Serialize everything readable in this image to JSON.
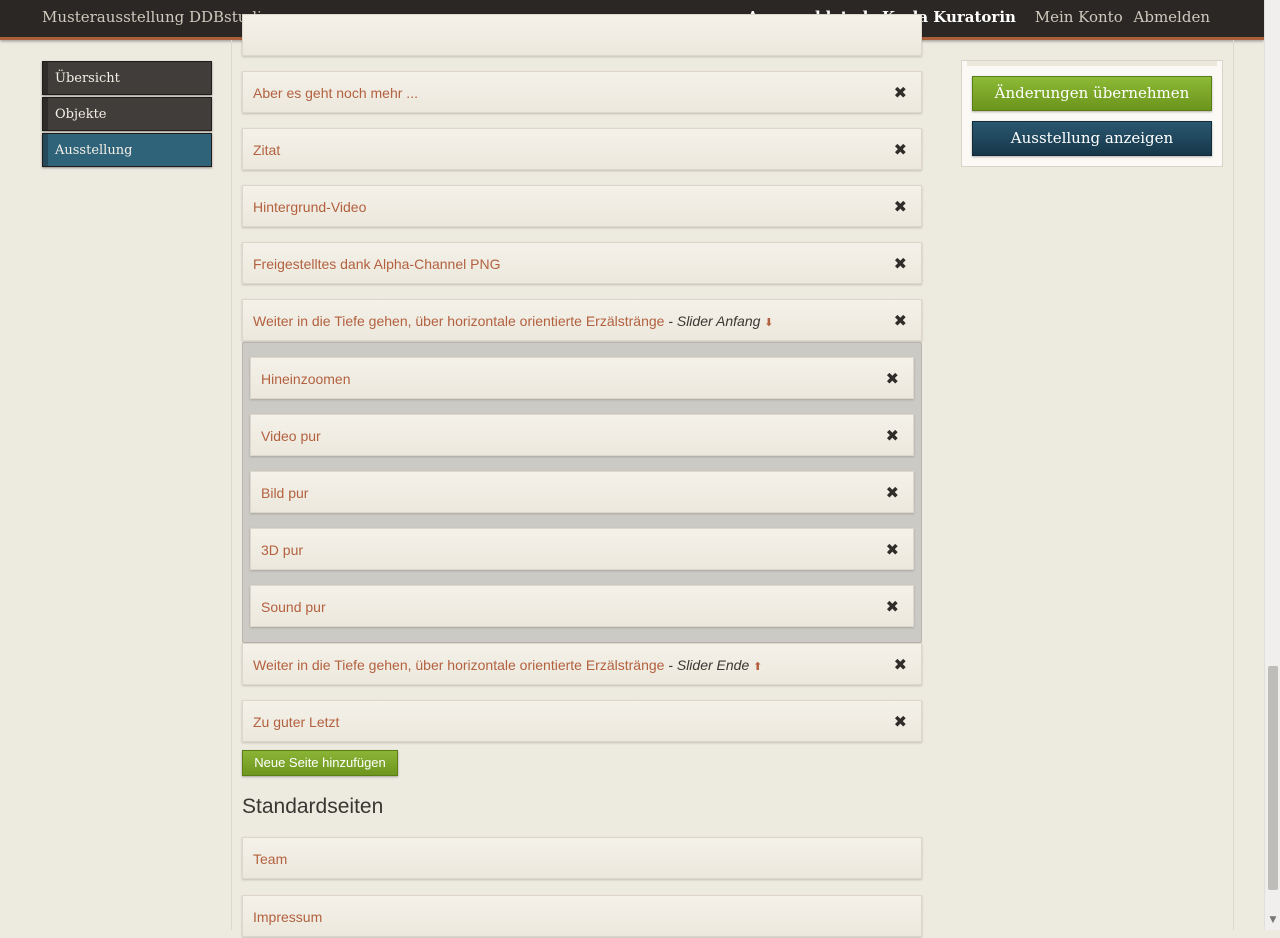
{
  "header": {
    "site_title": "Musterausstellung DDBstudio",
    "logged_in_as": "Angemeldet als Karla Kuratorin",
    "my_account": "Mein Konto",
    "logout": "Abmelden"
  },
  "sidebar": {
    "items": [
      {
        "label": "Übersicht",
        "active": false
      },
      {
        "label": "Objekte",
        "active": false
      },
      {
        "label": "Ausstellung",
        "active": true
      }
    ]
  },
  "pages": {
    "rows": [
      {
        "label": "Aber es geht noch mehr ..."
      },
      {
        "label": "Zitat"
      },
      {
        "label": "Hintergrund-Video"
      },
      {
        "label": "Freigestelltes dank Alpha-Channel PNG"
      },
      {
        "label": "Weiter in die Tiefe gehen, über horizontale orientierte Erzälstränge",
        "note": " - Slider Anfang ",
        "arrow": "⬇"
      }
    ],
    "slider_items": [
      {
        "label": "Hineinzoomen"
      },
      {
        "label": "Video pur"
      },
      {
        "label": "Bild pur"
      },
      {
        "label": "3D pur"
      },
      {
        "label": "Sound pur"
      }
    ],
    "after_rows": [
      {
        "label": "Weiter in die Tiefe gehen, über horizontale orientierte Erzälstränge",
        "note": " - Slider Ende ",
        "arrow": "⬆"
      },
      {
        "label": "Zu guter Letzt"
      }
    ],
    "remove_glyph": "✖",
    "add_button": "Neue Seite hinzufügen"
  },
  "standard_pages": {
    "title": "Standardseiten",
    "rows": [
      {
        "label": "Team"
      },
      {
        "label": "Impressum"
      }
    ]
  },
  "actions": {
    "apply": "Änderungen übernehmen",
    "show": "Ausstellung anzeigen"
  },
  "colors": {
    "topbar": "#2b2724",
    "accent_green": "#7aa52a",
    "accent_blue": "#1f4a60",
    "link": "#b3613f"
  }
}
